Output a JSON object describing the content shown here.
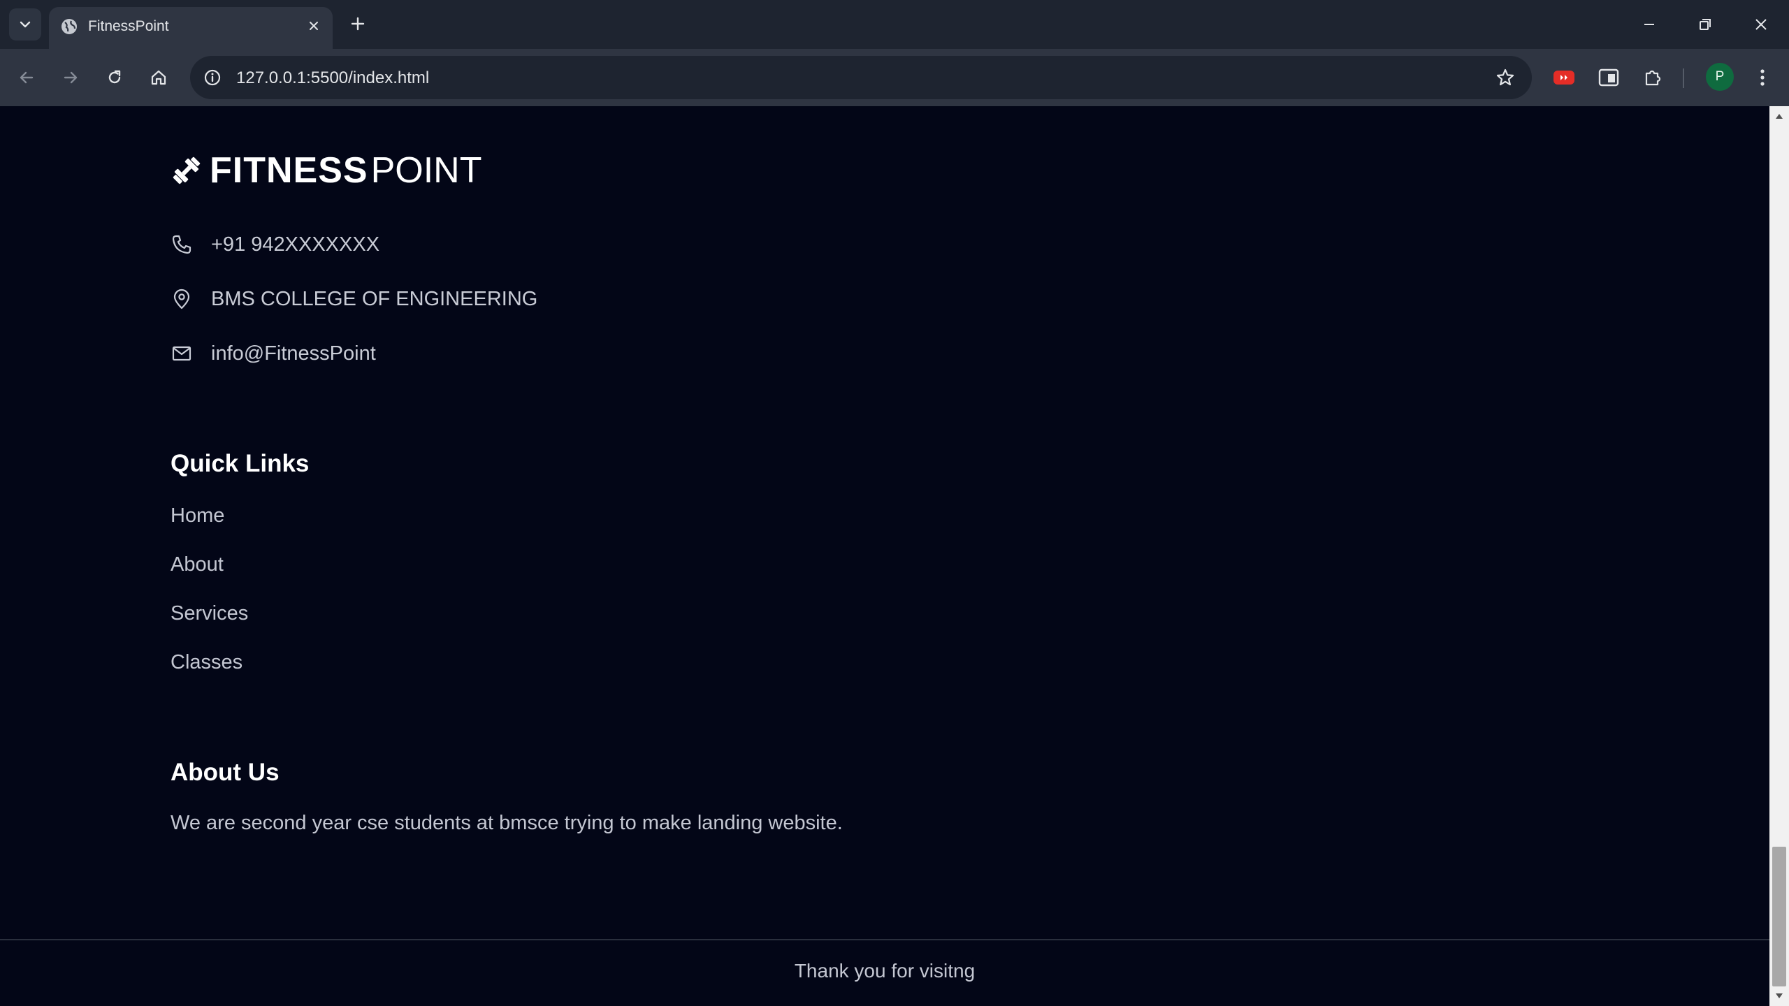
{
  "browser": {
    "tab_title": "FitnessPoint",
    "url": "127.0.0.1:5500/index.html",
    "profile_initial": "P"
  },
  "footer": {
    "logo_bold": "FITNESS",
    "logo_light": "POINT",
    "contact": {
      "phone": "+91 942XXXXXXX",
      "address": "BMS COLLEGE OF ENGINEERING",
      "email": "info@FitnessPoint"
    },
    "quick_links_title": "Quick Links",
    "links": [
      "Home",
      "About",
      "Services",
      "Classes"
    ],
    "about_title": "About Us",
    "about_text": "We are second year cse students at bmsce trying to make landing website.",
    "thank_you": "Thank you for visitng"
  },
  "colors": {
    "page_bg": "#030617",
    "chrome_tabbar": "#1e2430",
    "chrome_toolbar": "#2f3542",
    "text_muted": "#c4c7d2",
    "avatar_green": "#0f6b3f"
  },
  "icons": {
    "tab_search": "chevron-down-icon",
    "favicon": "globe-icon",
    "back": "arrow-left-icon",
    "forward": "arrow-right-icon",
    "reload": "reload-icon",
    "home": "home-icon",
    "site_info": "info-icon",
    "bookmark": "star-icon",
    "phone": "phone-icon",
    "location": "map-pin-icon",
    "email": "mail-icon",
    "logo": "dumbbell-icon"
  }
}
